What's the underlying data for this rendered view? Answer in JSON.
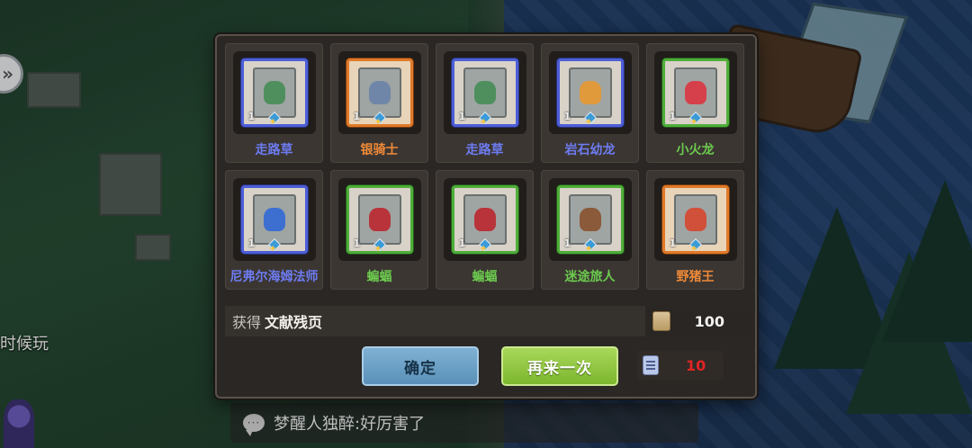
{
  "side": {
    "partial_text": "时候玩"
  },
  "chat": {
    "message": "梦醒人独醉:好厉害了"
  },
  "rewards": {
    "cards": [
      {
        "name": "走路草",
        "count": "1",
        "rarity": "blue",
        "creature_color": "#4f8f5e"
      },
      {
        "name": "银骑士",
        "count": "1",
        "rarity": "orange",
        "creature_color": "#6f86a8"
      },
      {
        "name": "走路草",
        "count": "1",
        "rarity": "blue",
        "creature_color": "#4f8f5e"
      },
      {
        "name": "岩石幼龙",
        "count": "1",
        "rarity": "blue",
        "creature_color": "#e09a3c"
      },
      {
        "name": "小火龙",
        "count": "1",
        "rarity": "green",
        "creature_color": "#d6404a"
      },
      {
        "name": "尼弗尔海姆法师",
        "count": "1",
        "rarity": "blue",
        "creature_color": "#3c6fd0"
      },
      {
        "name": "蝙蝠",
        "count": "1",
        "rarity": "green",
        "creature_color": "#b8343a"
      },
      {
        "name": "蝙蝠",
        "count": "1",
        "rarity": "green",
        "creature_color": "#b8343a"
      },
      {
        "name": "迷途旅人",
        "count": "1",
        "rarity": "green",
        "creature_color": "#8a5a3a"
      },
      {
        "name": "野猪王",
        "count": "1",
        "rarity": "orange",
        "creature_color": "#d0503a"
      }
    ],
    "bonus_prefix": "获得",
    "bonus_item": "文献残页",
    "bonus_amount": "100"
  },
  "buttons": {
    "confirm": "确定",
    "again": "再来一次"
  },
  "cost": {
    "value": "10"
  },
  "colors": {
    "blue": "#4d5ed6",
    "orange": "#e07a2a",
    "green": "#4fae3a",
    "cost_red": "#e02424"
  }
}
